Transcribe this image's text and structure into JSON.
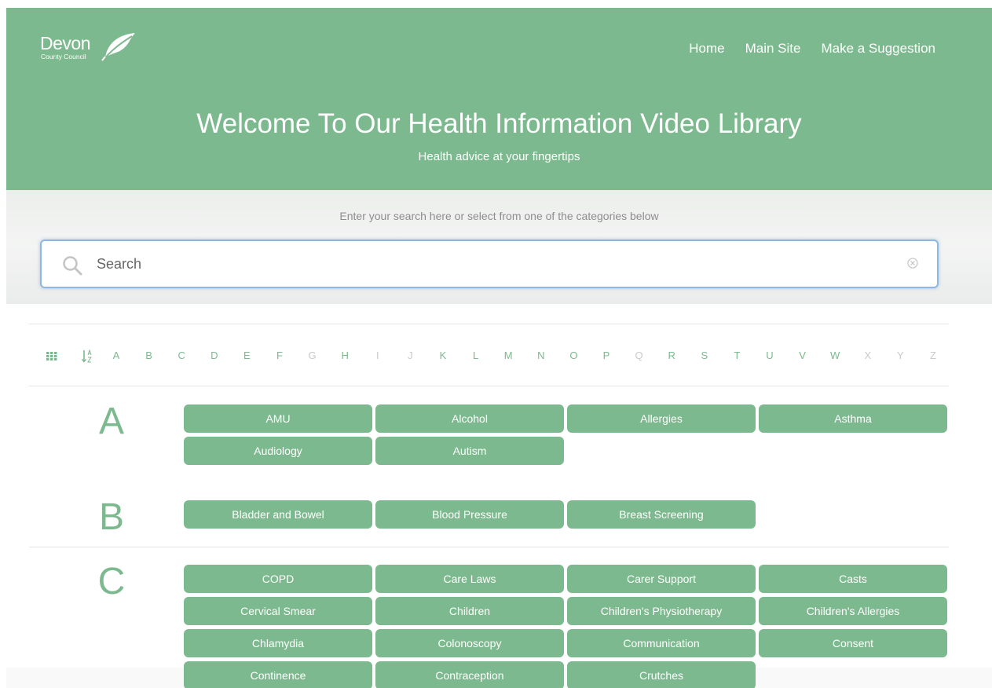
{
  "header": {
    "logo_name": "Devon",
    "logo_sub": "County Council",
    "nav": [
      "Home",
      "Main Site",
      "Make a Suggestion"
    ],
    "title": "Welcome To Our Health Information Video Library",
    "subtitle": "Health advice at your fingertips"
  },
  "search": {
    "hint": "Enter your search here or select from one of the categories below",
    "placeholder": "Search",
    "value": ""
  },
  "alphabet": {
    "letters": [
      "A",
      "B",
      "C",
      "D",
      "E",
      "F",
      "G",
      "H",
      "I",
      "J",
      "K",
      "L",
      "M",
      "N",
      "O",
      "P",
      "Q",
      "R",
      "S",
      "T",
      "U",
      "V",
      "W",
      "X",
      "Y",
      "Z"
    ],
    "disabled": [
      "G",
      "I",
      "J",
      "Q",
      "X",
      "Y",
      "Z"
    ]
  },
  "groups": [
    {
      "letter": "A",
      "topics": [
        "AMU",
        "Alcohol",
        "Allergies",
        "Asthma",
        "Audiology",
        "Autism"
      ]
    },
    {
      "letter": "B",
      "topics": [
        "Bladder and Bowel",
        "Blood Pressure",
        "Breast Screening"
      ]
    },
    {
      "letter": "C",
      "topics": [
        "COPD",
        "Care Laws",
        "Carer Support",
        "Casts",
        "Cervical Smear",
        "Children",
        "Children's Physiotherapy",
        "Children's Allergies",
        "Chlamydia",
        "Colonoscopy",
        "Communication",
        "Consent",
        "Continence",
        "Contraception",
        "Crutches"
      ]
    }
  ],
  "colors": {
    "brand": "#7db98e",
    "disabled": "#c9c9c9",
    "search_border": "#8fb7e0"
  },
  "icons": {
    "search": "search-icon",
    "clear": "clear-icon",
    "grid": "grid-view-icon",
    "sort": "sort-alpha-icon",
    "logo": "leaf-logo-icon"
  }
}
